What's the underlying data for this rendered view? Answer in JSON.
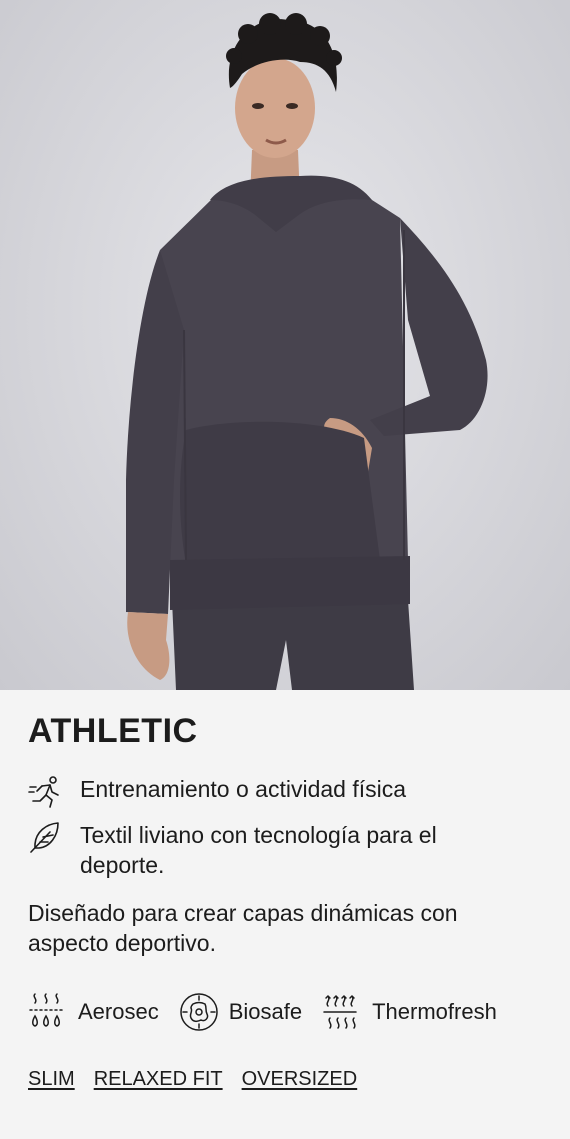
{
  "product": {
    "category": "ATHLETIC",
    "features": [
      {
        "icon": "running-person-icon",
        "text": "Entrenamiento o actividad física"
      },
      {
        "icon": "feather-icon",
        "text": "Textil liviano con tecnología para el deporte."
      }
    ],
    "description": "Diseñado para crear capas dinámicas con aspecto deportivo.",
    "technologies": [
      {
        "icon": "evaporation-drops-icon",
        "label": "Aerosec"
      },
      {
        "icon": "antibacterial-icon",
        "label": "Biosafe"
      },
      {
        "icon": "heat-waves-icon",
        "label": "Thermofresh"
      }
    ],
    "fits": [
      "SLIM",
      "RELAXED FIT",
      "OVERSIZED"
    ]
  },
  "colors": {
    "background": "#f4f4f4",
    "text": "#1c1c1c",
    "garment": "#48444f"
  }
}
